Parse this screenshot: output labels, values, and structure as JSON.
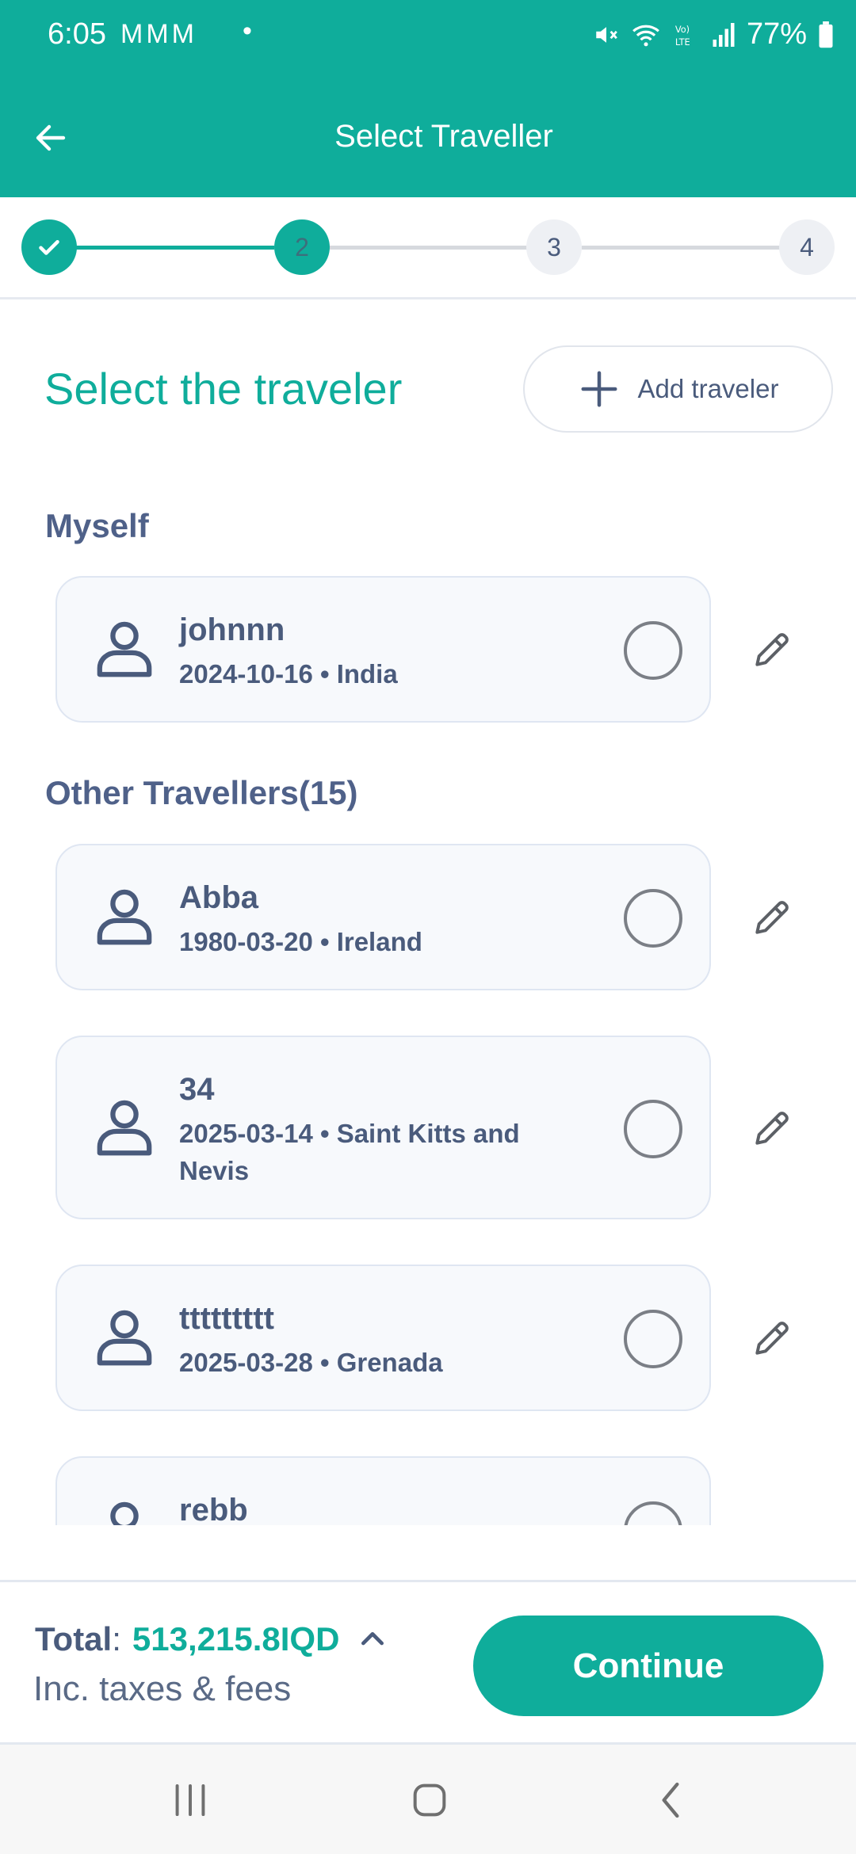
{
  "status_bar": {
    "time": "6:05",
    "notifications": "MMM",
    "dot": "•",
    "battery": "77%"
  },
  "header": {
    "title": "Select Traveller"
  },
  "stepper": {
    "steps": [
      {
        "label": "✓",
        "state": "done"
      },
      {
        "label": "2",
        "state": "active"
      },
      {
        "label": "3",
        "state": "todo"
      },
      {
        "label": "4",
        "state": "todo"
      }
    ]
  },
  "main": {
    "title": "Select the traveler",
    "add_button": "Add traveler",
    "myself_label": "Myself",
    "others_label": "Other Travellers(15)"
  },
  "myself": {
    "name": "johnnn",
    "meta": "2024-10-16 • India"
  },
  "travellers": [
    {
      "name": "Abba",
      "meta": "1980-03-20 • Ireland"
    },
    {
      "name": "34",
      "meta": "2025-03-14 • Saint Kitts and Nevis"
    },
    {
      "name": "ttttttttt",
      "meta": "2025-03-28 • Grenada"
    },
    {
      "name": "rebb",
      "meta": ""
    }
  ],
  "footer": {
    "total_label": "Total",
    "total_colon": ":",
    "total_value": "513,215.8IQD",
    "taxes": "Inc. taxes & fees",
    "continue": "Continue"
  },
  "colors": {
    "primary": "#0fad9b",
    "text": "#4a5b7c",
    "card_bg": "#f7f9fc"
  },
  "icons": {
    "back": "arrow-left-icon",
    "add": "plus-icon",
    "avatar": "person-icon",
    "edit": "pencil-icon",
    "expand": "chevron-up-icon"
  }
}
